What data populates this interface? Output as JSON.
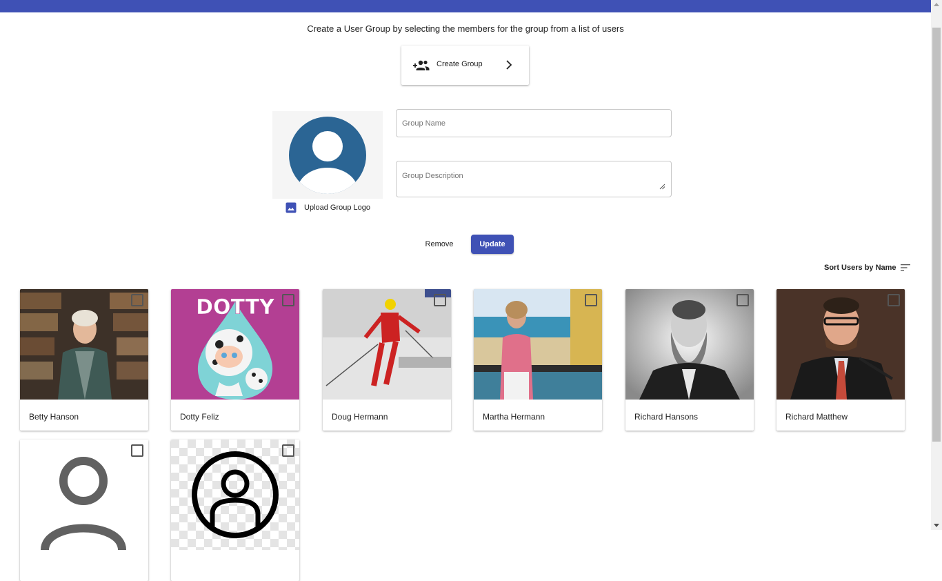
{
  "header": {
    "color": "#3f51b5"
  },
  "instruction": "Create a User Group by selecting the members for the group from a list of users",
  "create_group": {
    "label": "Create Group",
    "icon": "group-add-icon",
    "chevron": "chevron-right-icon"
  },
  "logo": {
    "upload_label": "Upload Group Logo",
    "placeholder_icon": "account-circle-icon",
    "upload_icon": "image-icon"
  },
  "form": {
    "group_name_placeholder": "Group Name",
    "group_description_placeholder": "Group Description"
  },
  "actions": {
    "remove_label": "Remove",
    "update_label": "Update"
  },
  "sort": {
    "label": "Sort Users by Name",
    "icon": "sort-icon"
  },
  "users": [
    {
      "name": "Betty Hanson",
      "checked": false
    },
    {
      "name": "Dotty Feliz",
      "checked": false
    },
    {
      "name": "Doug Hermann",
      "checked": false
    },
    {
      "name": "Martha Hermann",
      "checked": false
    },
    {
      "name": "Richard Hansons",
      "checked": false
    },
    {
      "name": "Richard Matthew",
      "checked": false
    },
    {
      "name": "",
      "checked": false
    },
    {
      "name": "",
      "checked": false
    }
  ],
  "colors": {
    "accent": "#3f51b5",
    "avatar_blue": "#2b6594"
  }
}
